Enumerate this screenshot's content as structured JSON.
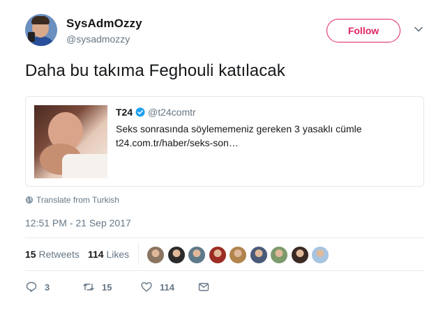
{
  "author": {
    "name": "SysAdmOzzy",
    "handle": "@sysadmozzy"
  },
  "follow_label": "Follow",
  "tweet_text": "Daha bu takıma Feghouli katılacak",
  "quoted": {
    "name": "T24",
    "handle": "@t24comtr",
    "text": "Seks sonrasında söylememeniz gereken 3 yasaklı cümle",
    "link": "t24.com.tr/haber/seks-son…"
  },
  "translate_label": "Translate from Turkish",
  "timestamp": "12:51 PM - 21 Sep 2017",
  "stats": {
    "retweets_count": "15",
    "retweets_label": "Retweets",
    "likes_count": "114",
    "likes_label": "Likes"
  },
  "likers": [
    {
      "color": "#8a7560"
    },
    {
      "color": "#2b2b2b"
    },
    {
      "color": "#5e7a8a"
    },
    {
      "color": "#9b2d24"
    },
    {
      "color": "#b0844d"
    },
    {
      "color": "#4a5a78"
    },
    {
      "color": "#7c9a6b"
    },
    {
      "color": "#3a2a24"
    },
    {
      "color": "#a7c4e0"
    }
  ],
  "actions": {
    "reply_count": "3",
    "retweet_count": "15",
    "like_count": "114"
  },
  "icons": [
    "chevron-down-icon",
    "verified-icon",
    "globe-icon",
    "reply-icon",
    "retweet-icon",
    "heart-icon",
    "message-icon"
  ],
  "colors": {
    "follow": "#e0245e",
    "muted": "#657786",
    "verified": "#1da1f2"
  }
}
